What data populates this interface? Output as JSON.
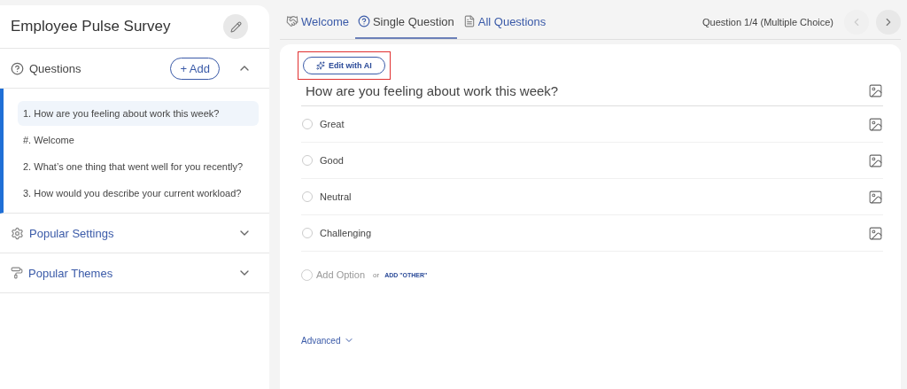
{
  "survey": {
    "title": "Employee Pulse Survey"
  },
  "questions_section": {
    "title": "Questions",
    "add_label": "+ Add",
    "expanded": true,
    "items": [
      {
        "number": "1.",
        "text": "How are you feeling about work this week?",
        "selected": true
      },
      {
        "number": "#.",
        "text": "Welcome",
        "selected": false
      },
      {
        "number": "2.",
        "text": "What’s one thing that went well for you recently?",
        "selected": false
      },
      {
        "number": "3.",
        "text": "How would you describe your current workload?",
        "selected": false
      }
    ]
  },
  "sections": [
    {
      "kind": "settings",
      "title": "Popular Settings",
      "expanded": false
    },
    {
      "kind": "themes",
      "title": "Popular Themes",
      "expanded": false
    }
  ],
  "tabs": [
    {
      "kind": "welcome",
      "label": "Welcome",
      "selected": false
    },
    {
      "kind": "single",
      "label": "Single Question",
      "selected": true
    },
    {
      "kind": "all",
      "label": "All Questions",
      "selected": false
    }
  ],
  "question_counter": "Question 1/4 (Multiple Choice)",
  "nav": {
    "prev_disabled": true,
    "next_disabled": false
  },
  "edit_ai": {
    "label": "Edit with AI",
    "highlighted": true
  },
  "question": {
    "text": "How are you feeling about work this week?"
  },
  "options": [
    {
      "label": "Great",
      "checked": false
    },
    {
      "label": "Good",
      "checked": false
    },
    {
      "label": "Neutral",
      "checked": false
    },
    {
      "label": "Challenging",
      "checked": false
    }
  ],
  "add_option": {
    "checked": false,
    "placeholder": "Add Option",
    "or": "or",
    "add_other": "ADD \"OTHER\""
  },
  "advanced": {
    "label": "Advanced",
    "expanded": false
  }
}
